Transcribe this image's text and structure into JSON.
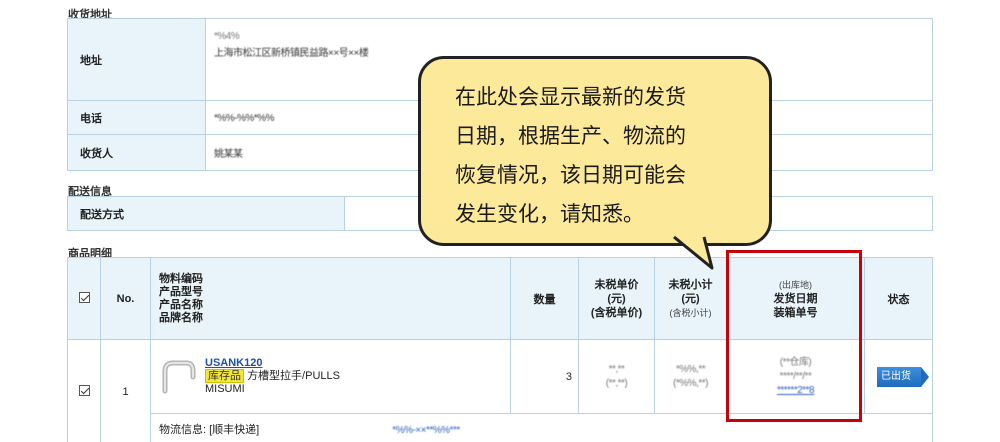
{
  "shipping_address": {
    "section_title": "收货地址",
    "address_label": "地址",
    "address_line1": "*%4%",
    "address_line2": "上海市松江区新桥镇民益路××号××楼",
    "phone_label": "电话",
    "phone_value": "*%%-%%*%%",
    "receiver_label": "收货人",
    "receiver_value": "姚某某"
  },
  "delivery_info": {
    "section_title": "配送信息",
    "method_label": "配送方式",
    "method_value": ""
  },
  "product_detail": {
    "section_title": "商品明细",
    "headers": {
      "no": "No.",
      "item_lines": [
        "物料编码",
        "产品型号",
        "产品名称",
        "品牌名称"
      ],
      "qty": "数量",
      "unit_price": "未税单价",
      "unit_price_unit": "(元)",
      "unit_price_sub": "(含税单价)",
      "subtotal": "未税小计",
      "subtotal_unit": "(元)",
      "subtotal_sub": "(含税小计)",
      "warehouse": "(出库地)",
      "ship_date": "发货日期",
      "box_no": "装箱单号",
      "status": "状态"
    },
    "rows": [
      {
        "no": "1",
        "code": "USANK120",
        "stock_tag": "库存品",
        "name": "方槽型拉手/PULLS",
        "brand": "MISUMI",
        "qty": "3",
        "unit_price": "**,**",
        "unit_price_tax": "(**,**)",
        "subtotal": "*%%,**",
        "subtotal_tax": "(*%%,**)",
        "warehouse": "(**仓库)",
        "ship_date": "****/**/**",
        "box_no": "******2**8",
        "status": "已出货"
      }
    ],
    "logistics_label": "物流信息: [顺丰快递]",
    "logistics_value": "*%%-××**%%***"
  },
  "callout": {
    "lines": [
      "在此处会显示最新的发货",
      "日期，根据生产、物流的",
      "恢复情况，该日期可能会",
      "发生变化，请知悉。"
    ]
  },
  "colors": {
    "label_bg": "#e9f3fa",
    "border": "#b9d2e3",
    "callout_bg": "#fde99a",
    "highlight": "#c8000a",
    "status_blue": "#1f6bbd"
  }
}
